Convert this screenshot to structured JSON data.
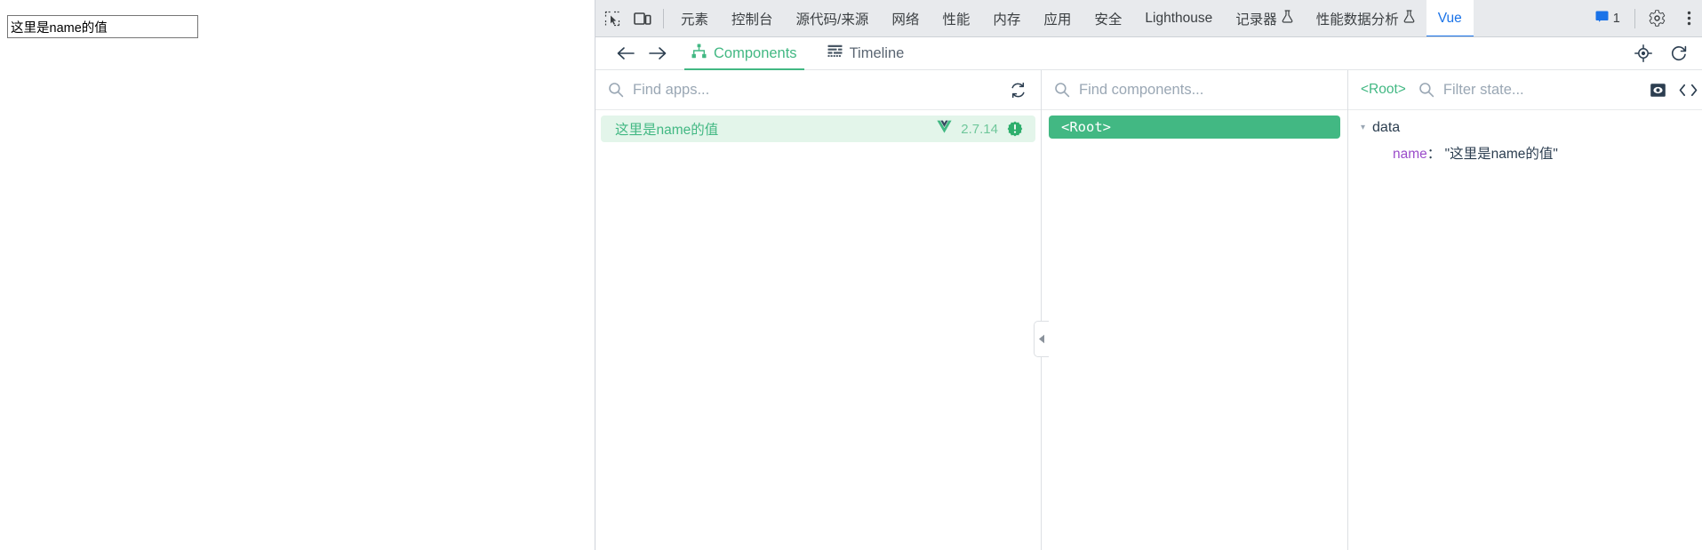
{
  "page": {
    "input_value": "这里是name的值",
    "input_placeholder": ""
  },
  "devtools": {
    "toolbar": {
      "inspect_icon": "inspect-element-icon",
      "device_icon": "device-toolbar-icon",
      "tabs": [
        {
          "label": "元素",
          "active": false
        },
        {
          "label": "控制台",
          "active": false
        },
        {
          "label": "源代码/来源",
          "active": false
        },
        {
          "label": "网络",
          "active": false
        },
        {
          "label": "性能",
          "active": false
        },
        {
          "label": "内存",
          "active": false
        },
        {
          "label": "应用",
          "active": false
        },
        {
          "label": "安全",
          "active": false
        },
        {
          "label": "Lighthouse",
          "active": false
        },
        {
          "label": "记录器",
          "active": false,
          "beaker": true
        },
        {
          "label": "性能数据分析",
          "active": false,
          "beaker": true
        },
        {
          "label": "Vue",
          "active": true
        }
      ],
      "issues_count": "1",
      "settings_icon": "gear-icon",
      "more_icon": "more-vertical-icon",
      "close_icon": "close-icon",
      "accent_active": "#1a73e8",
      "bar_bg": "#e8eaed"
    }
  },
  "vue": {
    "subbar": {
      "back_icon": "arrow-left-icon",
      "forward_icon": "arrow-right-icon",
      "tabs": [
        {
          "label": "Components",
          "icon": "component-tree-icon",
          "active": true
        },
        {
          "label": "Timeline",
          "icon": "timeline-icon",
          "active": false
        }
      ],
      "right_icons": [
        "target-select-icon",
        "refresh-icon",
        "more-vertical-icon"
      ],
      "accent": "#42b883"
    },
    "apps_pane": {
      "search_placeholder": "Find apps...",
      "search_value": "",
      "search_icon": "search-icon",
      "refresh_icon": "refresh-apps-icon",
      "rows": [
        {
          "name": "这里是name的值",
          "version": "2.7.14",
          "vue_logo": "vue-logo-icon",
          "badge": "warning-badge-icon",
          "selected": true
        }
      ]
    },
    "tree_pane": {
      "search_placeholder": "Find components...",
      "search_value": "",
      "search_icon": "search-icon",
      "nodes": [
        {
          "label": "<Root>",
          "selected": true
        }
      ]
    },
    "state_pane": {
      "breadcrumb": "<Root>",
      "search_placeholder": "Filter state...",
      "search_value": "",
      "search_icon": "search-icon",
      "right_icons": [
        "inspect-dom-icon",
        "open-in-editor-icon",
        "collapse-all-icon"
      ],
      "groups": [
        {
          "name": "data",
          "expanded": true,
          "caret": "▾",
          "entries": [
            {
              "key": "name",
              "colon": "：",
              "value": "\"这里是name的值\""
            }
          ]
        }
      ]
    },
    "collapse_handle_icon": "collapse-left-icon"
  }
}
